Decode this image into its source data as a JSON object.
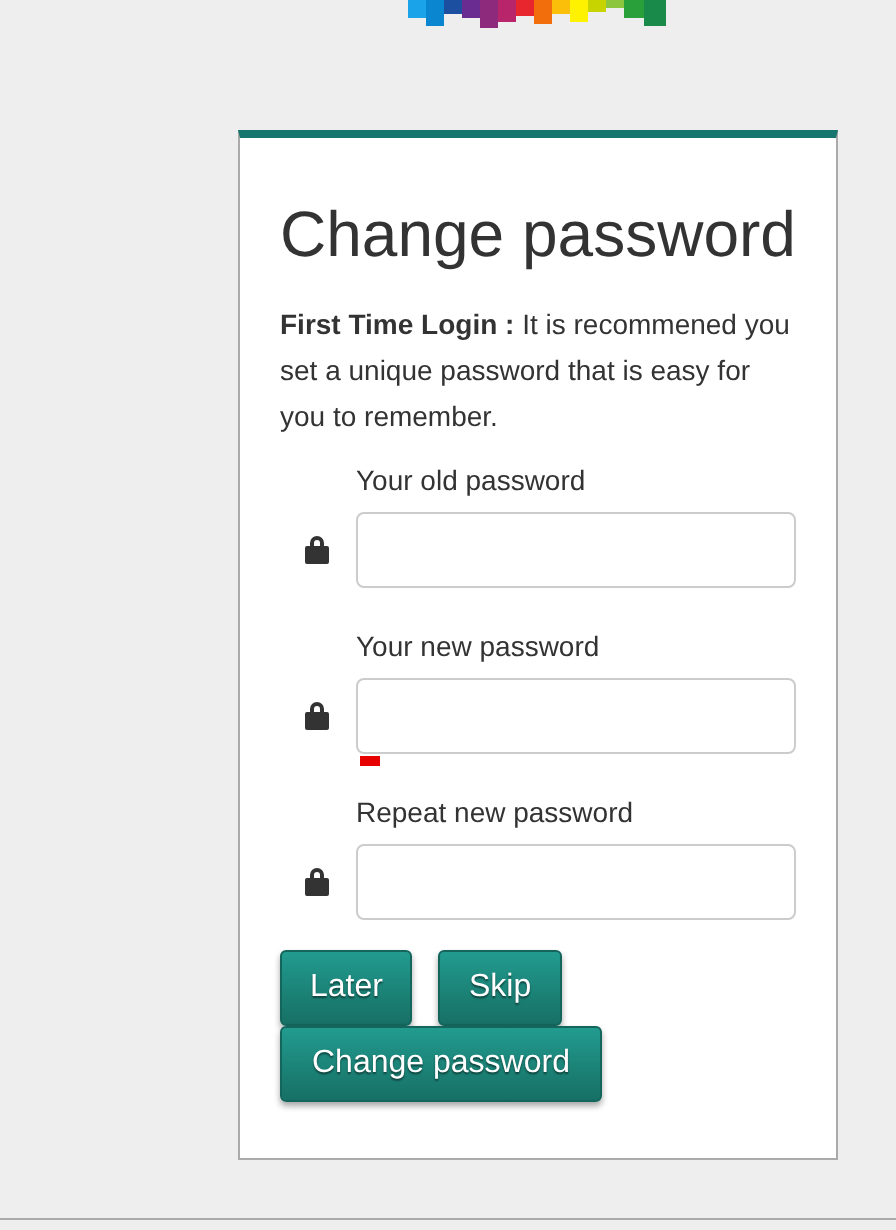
{
  "title": "Change password",
  "intro": "**First Time Login :** It is recommened you set a unique password that is easy for you to remember.",
  "fields": [
    {
      "label": "Your old password",
      "weak": false
    },
    {
      "label": "Your new password",
      "weak": true
    },
    {
      "label": "Repeat new password",
      "weak": false
    }
  ],
  "buttons": [
    {
      "label": "Later",
      "kind": "small"
    },
    {
      "label": "Skip",
      "kind": "small"
    },
    {
      "label": "Change password",
      "kind": "wide"
    }
  ]
}
